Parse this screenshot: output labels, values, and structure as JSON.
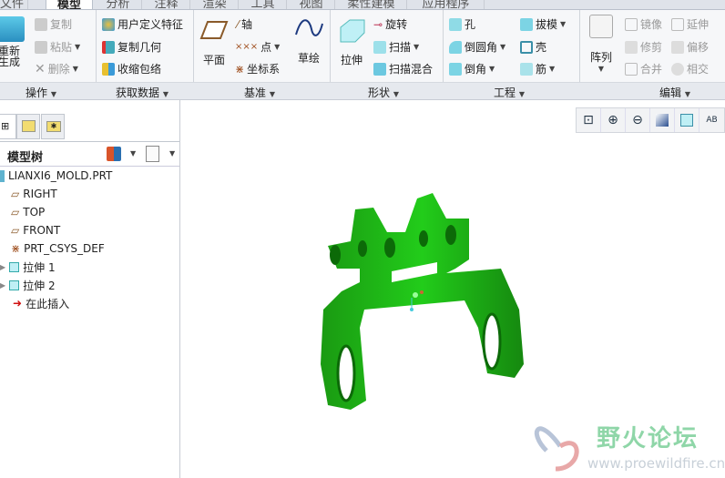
{
  "tabs": [
    "文件",
    "模型",
    "分析",
    "注释",
    "渲染",
    "工具",
    "视图",
    "柔性建模",
    "应用程序"
  ],
  "ribbon": {
    "operations": {
      "regenerate": "重新生成",
      "copy": "复制",
      "paste": "粘贴",
      "delete": "删除",
      "group": "操作"
    },
    "get_data": {
      "udf": "用户定义特征",
      "copy_geom": "复制几何",
      "shrinkwrap": "收缩包络",
      "group": "获取数据"
    },
    "datum": {
      "plane": "平面",
      "axis": "轴",
      "point": "点",
      "csys": "坐标系",
      "sketch": "草绘",
      "group": "基准"
    },
    "shapes": {
      "extrude": "拉伸",
      "revolve": "旋转",
      "sweep": "扫描",
      "swept_blend": "扫描混合",
      "group": "形状"
    },
    "engineering": {
      "hole": "孔",
      "round": "倒圆角",
      "chamfer": "倒角",
      "draft": "拔模",
      "shell": "壳",
      "rib": "筋",
      "group": "工程"
    },
    "editing": {
      "pattern": "阵列",
      "mirror": "镜像",
      "trim": "修剪",
      "merge": "合并",
      "extend": "延伸",
      "offset": "偏移",
      "intersect": "相交",
      "group": "编辑"
    }
  },
  "tree": {
    "title": "模型树",
    "items": [
      {
        "label": "LIANXI6_MOLD.PRT",
        "icon": "part-icon"
      },
      {
        "label": "RIGHT",
        "icon": "datum-plane-icon"
      },
      {
        "label": "TOP",
        "icon": "datum-plane-icon"
      },
      {
        "label": "FRONT",
        "icon": "datum-plane-icon"
      },
      {
        "label": "PRT_CSYS_DEF",
        "icon": "csys-icon"
      },
      {
        "label": "拉伸 1",
        "icon": "extrude-icon"
      },
      {
        "label": "拉伸 2",
        "icon": "extrude-icon"
      },
      {
        "label": "在此插入",
        "icon": "insert-arrow-icon"
      }
    ]
  },
  "watermark": {
    "name": "野火论坛",
    "url": "www.proewildfire.cn"
  },
  "colors": {
    "model": "#22cc1a",
    "accent": "#3a8fd0"
  }
}
